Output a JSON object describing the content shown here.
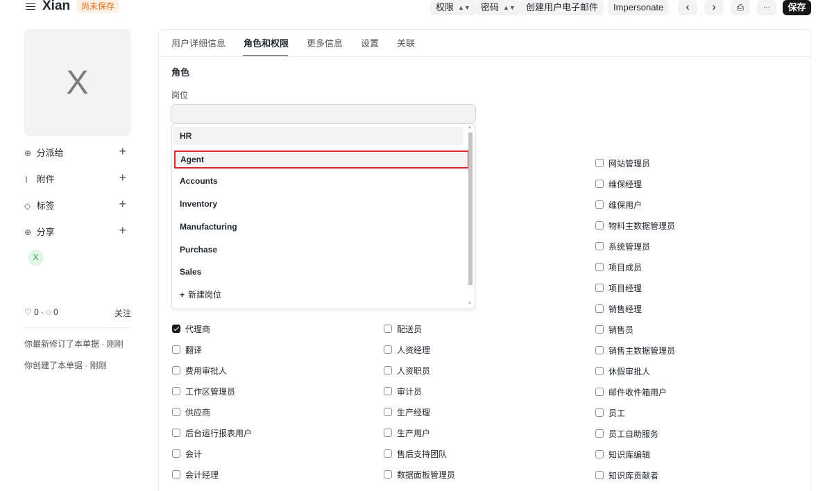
{
  "header": {
    "title": "Xian",
    "status_badge": "尚未保存",
    "buttons": {
      "permissions": "权限",
      "password": "密码",
      "create_email": "创建用户电子邮件",
      "impersonate": "Impersonate",
      "prev": "‹",
      "next": "›",
      "print": "⎙",
      "more": "···",
      "save": "保存"
    }
  },
  "sidebar": {
    "avatar_letter": "X",
    "assign": "分派给",
    "attachments": "附件",
    "tags": "标签",
    "share": "分享",
    "shared_user": "X",
    "likes": "0",
    "comments": "0",
    "follow": "关注",
    "activity": [
      "你最新修订了本单据 · 刚刚",
      "你创建了本单据 · 刚刚"
    ]
  },
  "tabs": [
    "用户详细信息",
    "角色和权限",
    "更多信息",
    "设置",
    "关联"
  ],
  "section": {
    "title": "角色",
    "field_label": "岗位",
    "field_value": ""
  },
  "dropdown": {
    "options": [
      "HR",
      "Agent",
      "Accounts",
      "Inventory",
      "Manufacturing",
      "Purchase",
      "Sales"
    ],
    "new_label": "新建岗位"
  },
  "roles": {
    "col1": [
      {
        "label": "代理商",
        "checked": true
      },
      {
        "label": "翻译",
        "checked": false
      },
      {
        "label": "费用审批人",
        "checked": false
      },
      {
        "label": "工作区管理员",
        "checked": false
      },
      {
        "label": "供应商",
        "checked": false
      },
      {
        "label": "后台运行报表用户",
        "checked": false
      },
      {
        "label": "会计",
        "checked": false
      },
      {
        "label": "会计经理",
        "checked": false
      }
    ],
    "col2": [
      {
        "label": "配送员",
        "checked": false
      },
      {
        "label": "人资经理",
        "checked": false
      },
      {
        "label": "人资职员",
        "checked": false
      },
      {
        "label": "审计员",
        "checked": false
      },
      {
        "label": "生产经理",
        "checked": false
      },
      {
        "label": "生产用户",
        "checked": false
      },
      {
        "label": "售后支持团队",
        "checked": false
      },
      {
        "label": "数据面板管理员",
        "checked": false
      }
    ],
    "col3": [
      {
        "label": "网站管理员",
        "checked": false
      },
      {
        "label": "维保经理",
        "checked": false
      },
      {
        "label": "维保用户",
        "checked": false
      },
      {
        "label": "物料主数据管理员",
        "checked": false
      },
      {
        "label": "系统管理员",
        "checked": false
      },
      {
        "label": "项目成员",
        "checked": false
      },
      {
        "label": "项目经理",
        "checked": false
      },
      {
        "label": "销售经理",
        "checked": false
      },
      {
        "label": "销售员",
        "checked": false
      },
      {
        "label": "销售主数据管理员",
        "checked": false
      },
      {
        "label": "休假审批人",
        "checked": false
      },
      {
        "label": "邮件收件箱用户",
        "checked": false
      },
      {
        "label": "员工",
        "checked": false
      },
      {
        "label": "员工自助服务",
        "checked": false
      },
      {
        "label": "知识库编辑",
        "checked": false
      },
      {
        "label": "知识库贡献者",
        "checked": false
      }
    ]
  }
}
